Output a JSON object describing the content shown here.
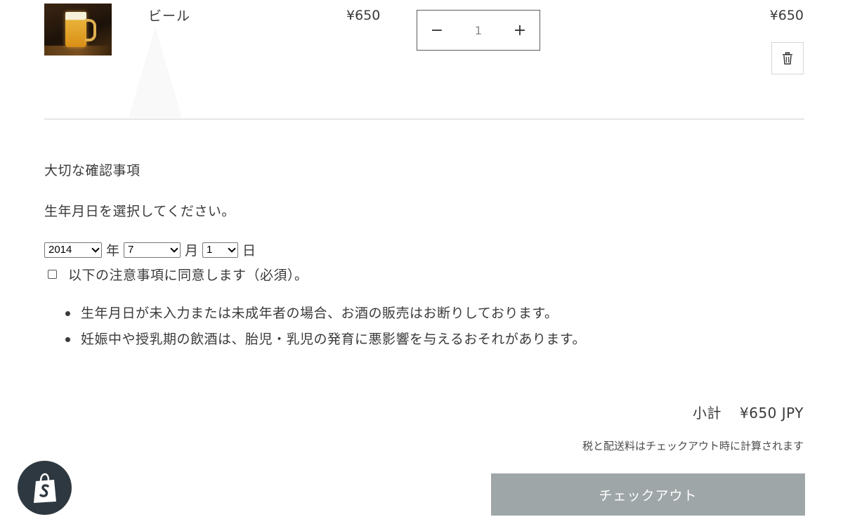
{
  "product": {
    "name": "ビール",
    "image_icon": "beer-mug-photo",
    "unit_price": "¥650",
    "quantity": "1",
    "line_total": "¥650",
    "decrease_symbol": "−",
    "increase_symbol": "+",
    "remove_icon": "trash-icon"
  },
  "notice": {
    "title": "大切な確認事項",
    "dob_prompt": "生年月日を選択してください。",
    "dob": {
      "year": "2014",
      "year_unit": "年",
      "month": "7",
      "month_unit": "月",
      "day": "1",
      "day_unit": "日"
    },
    "agree_label": "以下の注意事項に同意します（必須）。",
    "notes": [
      "生年月日が未入力または未成年者の場合、お酒の販売はお断りしております。",
      "妊娠中や授乳期の飲酒は、胎児・乳児の発育に悪影響を与えるおそれがあります。"
    ]
  },
  "summary": {
    "subtotal_label": "小計",
    "subtotal_value": "¥650 JPY",
    "tax_note": "税と配送料はチェックアウト時に計算されます",
    "checkout_label": "チェックアウト"
  },
  "badge": {
    "icon": "shopify-bag-icon"
  },
  "colors": {
    "checkout_bg": "#9fa6a7",
    "badge_bg": "#2e3840",
    "text": "#3a3a3a"
  }
}
